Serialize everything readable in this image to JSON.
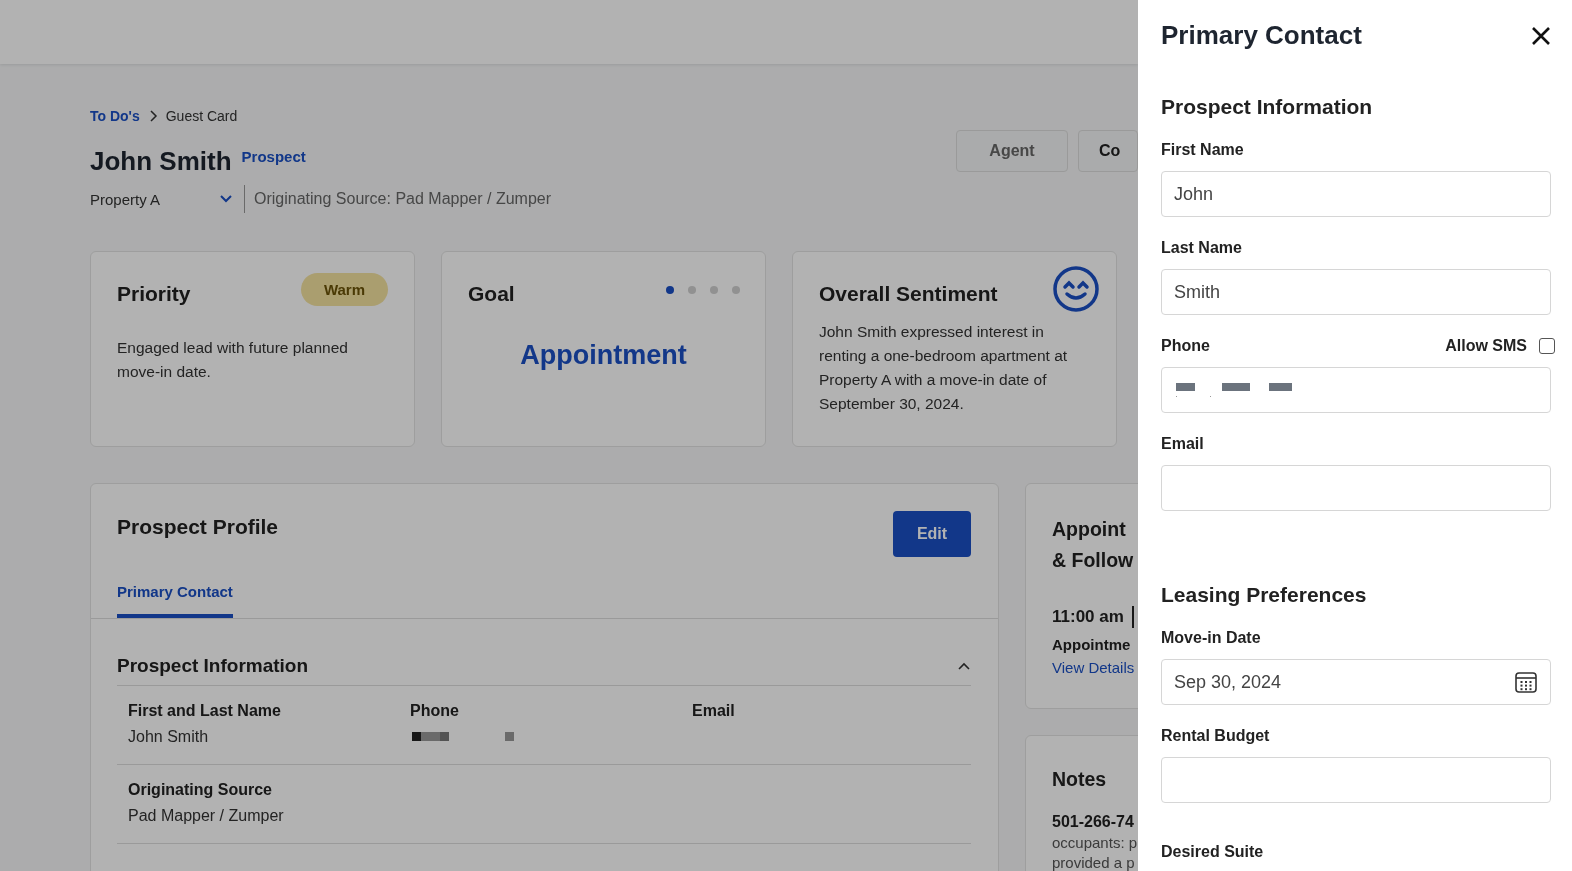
{
  "breadcrumb": [
    {
      "label": "To Do's",
      "link": true
    },
    {
      "label": "Guest Card",
      "link": false
    }
  ],
  "header": {
    "name": "John Smith",
    "status": "Prospect",
    "property": "Property A",
    "source": "Originating Source: Pad Mapper / Zumper",
    "buttons": [
      "Agent",
      "Co"
    ]
  },
  "cards": [
    {
      "kind": "priority",
      "title": "Priority",
      "badge": "Warm",
      "text": "Engaged lead with future planned move-in date."
    },
    {
      "kind": "goal",
      "title": "Goal",
      "steps": [
        {
          "selected": true
        },
        {
          "selected": false
        },
        {
          "selected": false
        },
        {
          "selected": false
        }
      ],
      "value": "Appointment"
    },
    {
      "kind": "sentiment",
      "title": "Overall Sentiment",
      "text": "John Smith expressed interest in renting a one-bedroom apartment at Property A with a move-in date of September 30, 2024."
    }
  ],
  "profile": {
    "title": "Prospect Profile",
    "edit": "Edit",
    "tabs": [
      {
        "label": "Primary Contact",
        "selected": true
      }
    ],
    "section": {
      "title": "Prospect Information",
      "expanded": true,
      "rows": [
        [
          {
            "label": "First and Last Name",
            "value": "John Smith"
          },
          {
            "label": "Phone",
            "redacted": true
          },
          {
            "label": "Email"
          }
        ],
        [
          {
            "label": "Originating Source",
            "value": "Pad Mapper / Zumper"
          }
        ]
      ]
    }
  },
  "appointments": {
    "title_lines": [
      "Appoint",
      "& Follow"
    ],
    "time": "11:00 am",
    "type": "Appointme",
    "link": "View Details"
  },
  "notes": {
    "title": "Notes",
    "phone": "501-266-74",
    "lines": [
      "occupants: p",
      "provided a p"
    ]
  },
  "drawer": {
    "title": "Primary Contact",
    "sections": [
      {
        "title": "Prospect Information",
        "fields": [
          {
            "kind": "text",
            "label": "First Name",
            "value": "John"
          },
          {
            "kind": "text",
            "label": "Last Name",
            "value": "Smith"
          },
          {
            "kind": "phone",
            "label": "Phone",
            "checkbox": {
              "label": "Allow SMS",
              "checked": false
            }
          },
          {
            "kind": "text",
            "label": "Email"
          }
        ]
      },
      {
        "title": "Leasing Preferences",
        "fields": [
          {
            "kind": "date",
            "label": "Move-in Date",
            "value": "Sep 30, 2024"
          },
          {
            "kind": "text",
            "label": "Rental Budget"
          },
          {
            "kind": "label",
            "label": "Desired Suite"
          }
        ]
      }
    ]
  }
}
